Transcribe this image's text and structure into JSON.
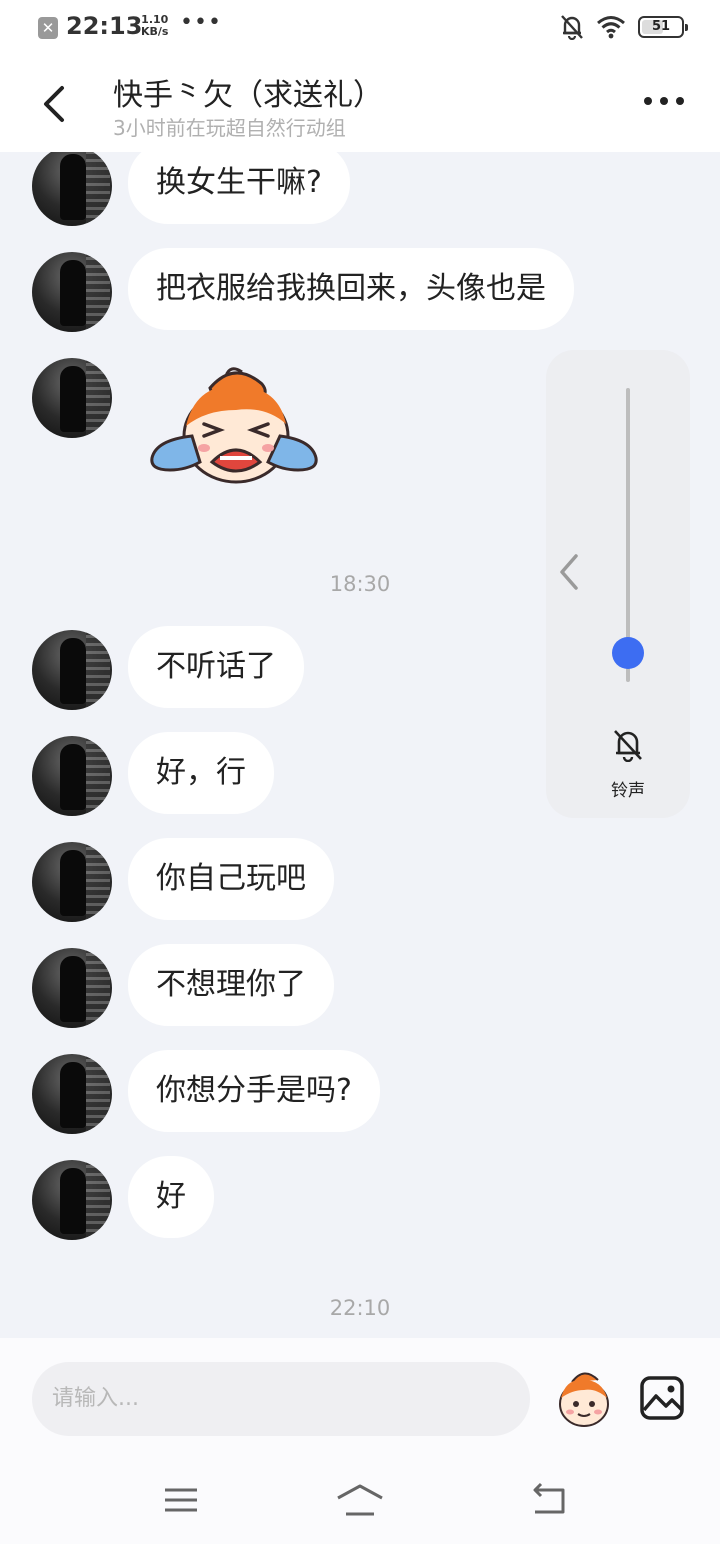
{
  "status_bar": {
    "time": "22:13",
    "net_speed_value": "1.10",
    "net_speed_unit": "KB/s",
    "more_indicator": "•••",
    "battery_level": "51",
    "notification_icon": "close-notification-icon",
    "mute_icon": "bell-off-icon",
    "wifi_icon": "wifi-icon"
  },
  "header": {
    "title": "快手⺀欠（求送礼）",
    "subtitle": "3小时前在玩超自然行动组",
    "back_icon": "chevron-left-icon",
    "more_icon": "more-dots-icon"
  },
  "messages": [
    {
      "text": "换女生干嘛?"
    },
    {
      "text": "把衣服给我换回来，头像也是"
    },
    {
      "sticker": "crying-mascot-sticker"
    },
    {
      "text": "不听话了"
    },
    {
      "text": "好，行"
    },
    {
      "text": "你自己玩吧"
    },
    {
      "text": "不想理你了"
    },
    {
      "text": "你想分手是吗?"
    },
    {
      "text": "好"
    }
  ],
  "timestamps": [
    "18:30",
    "22:10"
  ],
  "volume_panel": {
    "label": "铃声",
    "level_fraction": 0.1,
    "icon": "bell-off-icon",
    "accent": "#3d6df2"
  },
  "input": {
    "placeholder": "请输入..."
  },
  "colors": {
    "chat_background": "#f1f3f8",
    "bubble": "#ffffff",
    "accent": "#3d6df2"
  }
}
